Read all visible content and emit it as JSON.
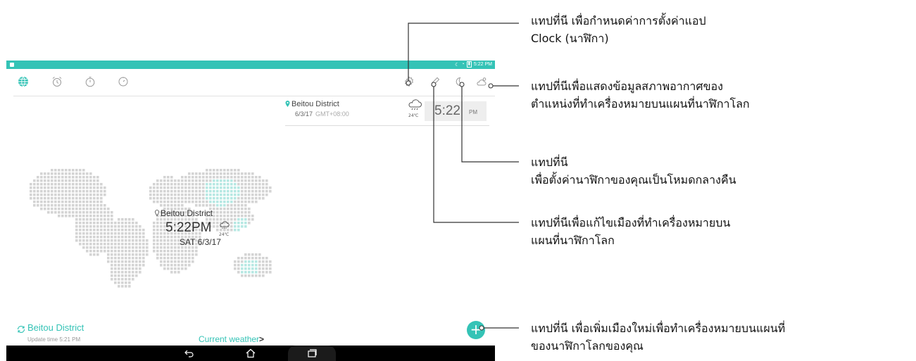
{
  "status_bar": {
    "time": "5:22 PM"
  },
  "tabs": [
    {
      "name": "world-clock",
      "icon": "globe-icon"
    },
    {
      "name": "alarm",
      "icon": "alarm-icon"
    },
    {
      "name": "stopwatch",
      "icon": "stopwatch-icon"
    },
    {
      "name": "timer",
      "icon": "timer-icon"
    }
  ],
  "actions": [
    {
      "name": "settings",
      "icon": "gear-icon"
    },
    {
      "name": "edit",
      "icon": "pencil-icon"
    },
    {
      "name": "night-mode",
      "icon": "moon-icon"
    },
    {
      "name": "weather",
      "icon": "cloud-sun-icon"
    }
  ],
  "city_card": {
    "city": "Beitou District",
    "date": "6/3/17",
    "gmt": "GMT+08:00",
    "temperature": "24℃",
    "time": "5:22",
    "ampm": "PM"
  },
  "map_overlay": {
    "city": "Beitou District",
    "time": "5:22PM",
    "temperature": "24℃",
    "date": "SAT 6/3/17"
  },
  "bottom": {
    "city": "Beitou District",
    "update_time": "Update time 5:21 PM",
    "current_weather": "Current weather",
    "chevron": ">"
  },
  "fab_label": "+",
  "callouts": {
    "settings": [
      "แทปที่นี เพื่อกำหนดค่าการตั้งค่าแอป",
      "Clock (นาฬิกา)"
    ],
    "weather": [
      "แทปที่นีเพื่อแสดงข้อมูลสภาพอากาศของ",
      "ตำแหน่งที่ทำเครื่องหมายบนแผนที่นาฬิกาโลก"
    ],
    "night_mode": [
      "แทปที่นี",
      "เพื่อตั้งค่านาฬิกาของคุณเป็นโหมดกลางคืน"
    ],
    "edit": [
      "แทปที่นีเพื่อแก้ไขเมืองที่ทำเครื่องหมายบน",
      "แผนที่นาฬิกาโลก"
    ],
    "add_city": [
      "แทปที่นี เพื่อเพิ่มเมืองใหม่เพื่อทำเครื่องหมายบนแผนที่",
      "ของนาฬิกาโลกของคุณ"
    ]
  },
  "colors": {
    "accent": "#34c3b6",
    "map_dot": "#d4d4d4",
    "map_dot_highlight": "#b7e8e3"
  }
}
